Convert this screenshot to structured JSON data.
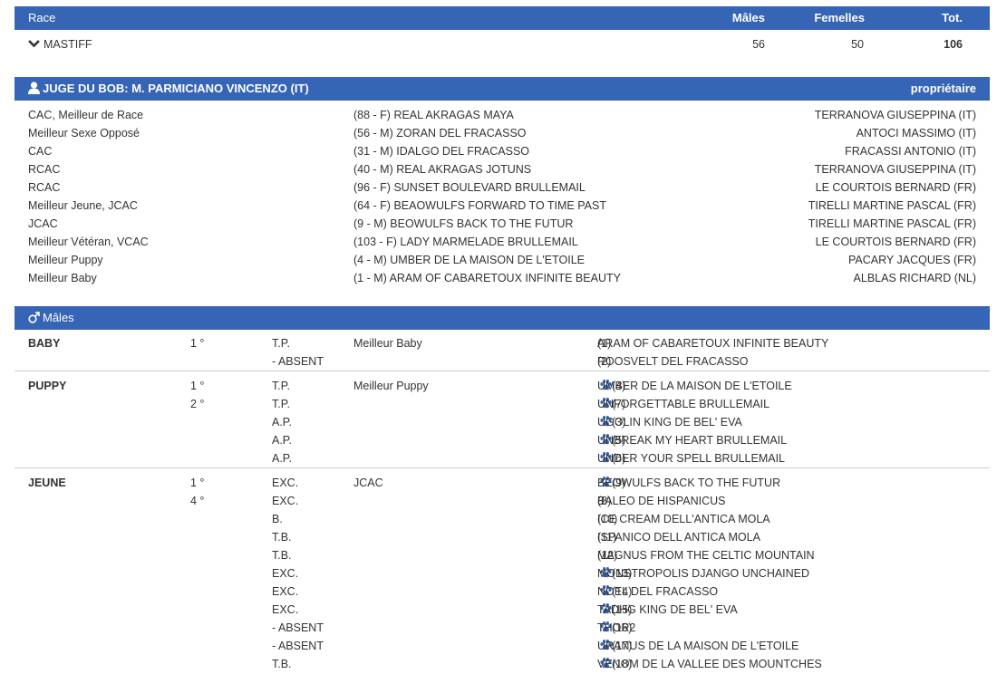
{
  "race_table": {
    "headers": {
      "race": "Race",
      "males": "Mâles",
      "femelles": "Femelles",
      "total": "Tot."
    },
    "row": {
      "name": "MASTIFF",
      "males": "56",
      "femelles": "50",
      "total": "106"
    }
  },
  "judge": {
    "title": "JUGE DU BOB: M. PARMICIANO VINCENZO (IT)",
    "owner_header": "propriétaire",
    "awards": [
      {
        "title": "CAC, Meilleur de Race",
        "dog": "(88 - F) REAL AKRAGAS MAYA",
        "owner": "TERRANOVA GIUSEPPINA (IT)"
      },
      {
        "title": "Meilleur Sexe Opposé",
        "dog": "(56 - M) ZORAN DEL FRACASSO",
        "owner": "ANTOCI MASSIMO (IT)"
      },
      {
        "title": "CAC",
        "dog": "(31 - M) IDALGO DEL FRACASSO",
        "owner": "FRACASSI ANTONIO (IT)"
      },
      {
        "title": "RCAC",
        "dog": "(40 - M) REAL AKRAGAS JOTUNS",
        "owner": "TERRANOVA GIUSEPPINA (IT)"
      },
      {
        "title": "RCAC",
        "dog": "(96 - F) SUNSET BOULEVARD BRULLEMAIL",
        "owner": "LE COURTOIS BERNARD (FR)"
      },
      {
        "title": "Meilleur Jeune, JCAC",
        "dog": "(64 - F) BEAOWULFS FORWARD TO TIME PAST",
        "owner": "TIRELLI MARTINE PASCAL (FR)"
      },
      {
        "title": "JCAC",
        "dog": "(9 - M) BEOWULFS BACK TO THE FUTUR",
        "owner": "TIRELLI MARTINE PASCAL (FR)"
      },
      {
        "title": "Meilleur Vétéran, VCAC",
        "dog": "(103 - F) LADY MARMELADE BRULLEMAIL",
        "owner": "LE COURTOIS BERNARD (FR)"
      },
      {
        "title": "Meilleur Puppy",
        "dog": "(4 - M) UMBER DE LA MAISON DE L'ETOILE",
        "owner": "PACARY JACQUES (FR)"
      },
      {
        "title": "Meilleur Baby",
        "dog": "(1 - M) ARAM OF CABARETOUX INFINITE BEAUTY",
        "owner": "ALBLAS RICHARD (NL)"
      }
    ]
  },
  "males": {
    "header": "Mâles",
    "classes": [
      {
        "name": "BABY",
        "entries": [
          {
            "place": "1 °",
            "grade": "T.P.",
            "award": "Meilleur Baby",
            "dog": "ARAM OF CABARETOUX INFINITE BEAUTY",
            "paw": false,
            "num": "(1)"
          },
          {
            "place": "",
            "grade": "- ABSENT",
            "award": "",
            "dog": "ROOSVELT DEL FRACASSO",
            "paw": false,
            "num": "(2)"
          }
        ]
      },
      {
        "name": "PUPPY",
        "entries": [
          {
            "place": "1 °",
            "grade": "T.P.",
            "award": "Meilleur Puppy",
            "dog": "UMBER DE LA MAISON DE L'ETOILE",
            "paw": true,
            "num": "(4)"
          },
          {
            "place": "2 °",
            "grade": "T.P.",
            "award": "",
            "dog": "UNFORGETTABLE BRULLEMAIL",
            "paw": true,
            "num": "(7)"
          },
          {
            "place": "",
            "grade": "A.P.",
            "award": "",
            "dog": "UGOLIN KING DE BEL' EVA",
            "paw": true,
            "num": "(3)"
          },
          {
            "place": "",
            "grade": "A.P.",
            "award": "",
            "dog": "UNBREAK MY HEART BRULLEMAIL",
            "paw": true,
            "num": "(5)"
          },
          {
            "place": "",
            "grade": "A.P.",
            "award": "",
            "dog": "UNDER YOUR SPELL BRULLEMAIL",
            "paw": true,
            "num": "(6)"
          }
        ]
      },
      {
        "name": "JEUNE",
        "entries": [
          {
            "place": "1 °",
            "grade": "EXC.",
            "award": "JCAC",
            "dog": "BEOWULFS BACK TO THE FUTUR",
            "paw": true,
            "num": "(9)"
          },
          {
            "place": "4 °",
            "grade": "EXC.",
            "award": "",
            "dog": "BALEO DE HISPANICUS",
            "paw": false,
            "num": "(8)"
          },
          {
            "place": "",
            "grade": "B.",
            "award": "",
            "dog": "ICE CREAM DELL'ANTICA MOLA",
            "paw": false,
            "num": "(10)"
          },
          {
            "place": "",
            "grade": "T.B.",
            "award": "",
            "dog": "ISPANICO DELL ANTICA MOLA",
            "paw": false,
            "num": "(11)"
          },
          {
            "place": "",
            "grade": "T.B.",
            "award": "",
            "dog": "MAGNUS FROM THE CELTIC MOUNTAIN",
            "paw": false,
            "num": "(12)"
          },
          {
            "place": "",
            "grade": "EXC.",
            "award": "",
            "dog": "MONSTROPOLIS DJANGO UNCHAINED",
            "paw": true,
            "num": "(13)"
          },
          {
            "place": "",
            "grade": "EXC.",
            "award": "",
            "dog": "NOEL DEL FRACASSO",
            "paw": true,
            "num": "(14)"
          },
          {
            "place": "",
            "grade": "EXC.",
            "award": "",
            "dog": "TADHG KING DE BEL' EVA",
            "paw": true,
            "num": "(15)"
          },
          {
            "place": "",
            "grade": "- ABSENT",
            "award": "",
            "dog": "THOR2",
            "paw": true,
            "num": "(16)"
          },
          {
            "place": "",
            "grade": "- ABSENT",
            "award": "",
            "dog": "URANUS DE LA MAISON DE L'ETOILE",
            "paw": true,
            "num": "(17)"
          },
          {
            "place": "",
            "grade": "T.B.",
            "award": "",
            "dog": "VENOM DE LA VALLEE DES MOUNTCHES",
            "paw": true,
            "num": "(18)"
          }
        ]
      }
    ]
  },
  "colors": {
    "header_bg": "#3765b5",
    "header_text": "#ffffff",
    "text": "#333333",
    "paw": "#3765b5"
  },
  "icons": {
    "expand": "chevron-down-icon",
    "judge": "user-icon",
    "males": "male-symbol-icon",
    "paw": "paw-icon"
  }
}
